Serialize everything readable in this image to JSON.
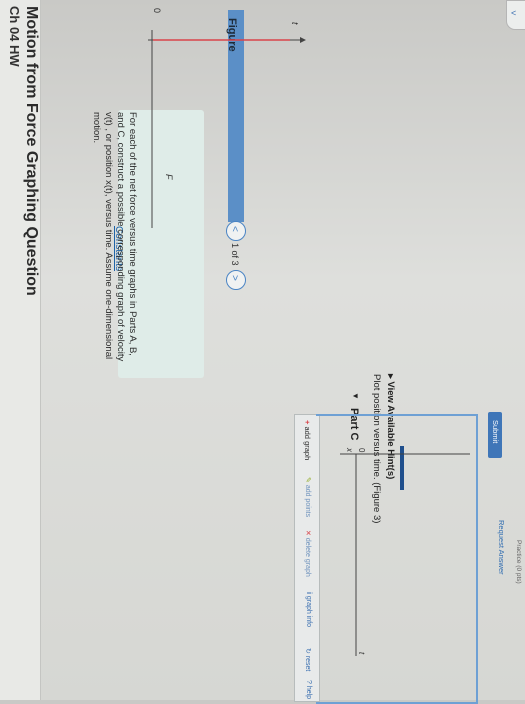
{
  "header": {
    "topic": "Ch 04 HW",
    "title": "Motion from Force Graphing Question"
  },
  "problem": {
    "constants_link": "Constants",
    "text": "For each of the net force versus time graphs in Parts A, B, and C, construct a possible corresponding graph of velocity v(t) , or position x(t), versus time. Assume one-dimensional motion."
  },
  "figure": {
    "label": "Figure",
    "pager": "1 of 3",
    "prev": "<",
    "next": ">",
    "y_axis": "F",
    "origin": "0",
    "x_axis": "t"
  },
  "part_c": {
    "heading": "Part C",
    "instruction": "Plot position versus time. (Figure 3)",
    "hints": "View Available Hint(s)"
  },
  "toolbar": {
    "add_graph": "add graph",
    "add_points": "add points",
    "delete_graph": "delete graph",
    "graph_info": "graph info",
    "reset": "reset",
    "help": "help"
  },
  "graph": {
    "y_axis": "x",
    "origin": "0",
    "x_axis": "t"
  },
  "actions": {
    "submit": "Submit",
    "request_answer": "Request Answer",
    "practice": "Practice (0 pts)"
  },
  "colors": {
    "accent": "#5b8fc7",
    "link": "#1f64a8",
    "force_line": "#d9444a"
  }
}
